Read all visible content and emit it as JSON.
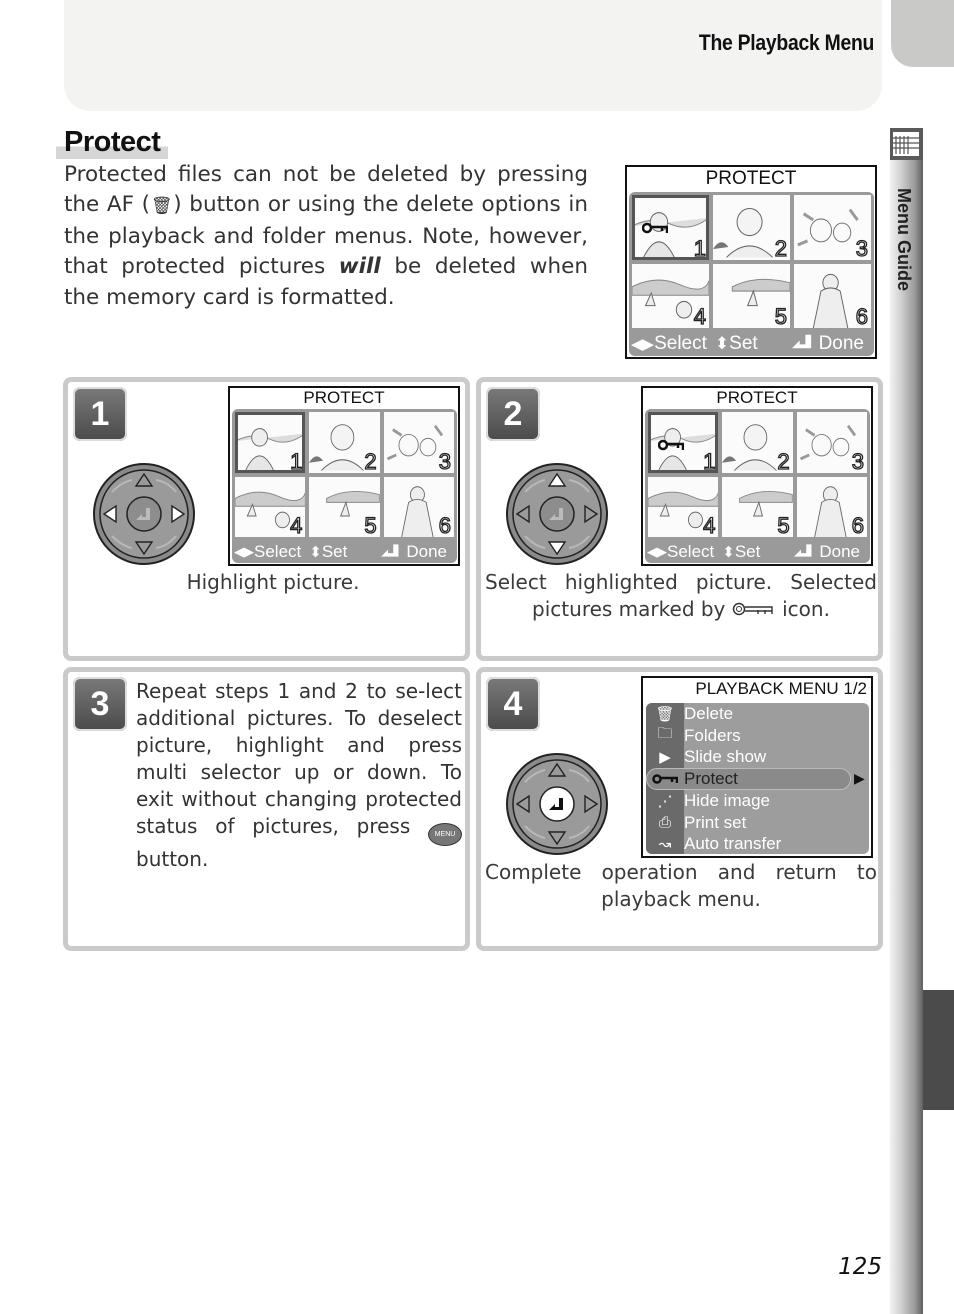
{
  "header": {
    "title": "The Playback Menu"
  },
  "side_tab": {
    "label": "Menu Guide",
    "icon": "menu-guide-icon"
  },
  "page_number": "125",
  "section": {
    "title": "Protect",
    "intro_before_icon": "Protected files can not be deleted by pressing the AF (",
    "intro_icon": "trash-icon",
    "intro_after_icon": ") button or using the delete options in the playback and folder menus.  Note, however, that protected pictures ",
    "intro_emphasis": "will",
    "intro_end": " be deleted when the memory card is formatted."
  },
  "lcd_protect": {
    "title": "PROTECT",
    "thumbnails": [
      {
        "number": "1",
        "subject": "woman-by-lake",
        "protected": true,
        "selected": true
      },
      {
        "number": "2",
        "subject": "boy-portrait",
        "protected": false,
        "selected": false
      },
      {
        "number": "3",
        "subject": "flowers",
        "protected": false,
        "selected": false
      },
      {
        "number": "4",
        "subject": "boy-by-sailboat",
        "protected": false,
        "selected": false
      },
      {
        "number": "5",
        "subject": "sailboat",
        "protected": false,
        "selected": false
      },
      {
        "number": "6",
        "subject": "woman-standing",
        "protected": false,
        "selected": false
      }
    ],
    "footer": {
      "select_icon": "◂▸",
      "select_label": "Select",
      "set_icon": "⬍",
      "set_label": "Set",
      "done_icon": "◢┛",
      "done_label": "Done"
    }
  },
  "steps": [
    {
      "number": "1",
      "caption": "Highlight picture.",
      "multi_selector_highlight": "left-right",
      "lcd": {
        "title": "PROTECT",
        "thumbnails": [
          {
            "number": "1",
            "protected": false,
            "selected": true
          },
          {
            "number": "2",
            "protected": false,
            "selected": false
          },
          {
            "number": "3",
            "protected": false,
            "selected": false
          },
          {
            "number": "4",
            "protected": false,
            "selected": false
          },
          {
            "number": "5",
            "protected": false,
            "selected": false
          },
          {
            "number": "6",
            "protected": false,
            "selected": false
          }
        ],
        "footer": {
          "select_label": "Select",
          "set_label": "Set",
          "done_label": "Done"
        }
      }
    },
    {
      "number": "2",
      "caption_before_icon": "Select highlighted picture.  Selected pictures marked by ",
      "caption_icon": "key-icon",
      "caption_after_icon": " icon.",
      "multi_selector_highlight": "up-down",
      "lcd": {
        "title": "PROTECT",
        "thumbnails": [
          {
            "number": "1",
            "protected": true,
            "selected": true
          },
          {
            "number": "2",
            "protected": false,
            "selected": false
          },
          {
            "number": "3",
            "protected": false,
            "selected": false
          },
          {
            "number": "4",
            "protected": false,
            "selected": false
          },
          {
            "number": "5",
            "protected": false,
            "selected": false
          },
          {
            "number": "6",
            "protected": false,
            "selected": false
          }
        ],
        "footer": {
          "select_label": "Select",
          "set_label": "Set",
          "done_label": "Done"
        }
      }
    },
    {
      "number": "3",
      "text_before_icon": "Repeat steps 1 and 2 to se-lect additional pictures.  To deselect picture, highlight and press multi selector up or down.  To exit without changing protected status of pictures, press ",
      "text_icon_label": "MENU",
      "text_after_icon": " button."
    },
    {
      "number": "4",
      "caption": "Complete operation and return to playback menu.",
      "multi_selector_highlight": "center",
      "menu": {
        "title": "PLAYBACK MENU 1/2",
        "items": [
          {
            "label": "Delete",
            "icon": "trash-icon",
            "glyph": "🗑",
            "active": false
          },
          {
            "label": "Folders",
            "icon": "folder-icon",
            "glyph": "🗀",
            "active": false
          },
          {
            "label": "Slide show",
            "icon": "slideshow-icon",
            "glyph": "▶",
            "active": false
          },
          {
            "label": "Protect",
            "icon": "key-icon",
            "glyph": "o━╖",
            "active": true
          },
          {
            "label": "Hide image",
            "icon": "hide-image-icon",
            "glyph": "⋰",
            "active": false
          },
          {
            "label": "Print set",
            "icon": "print-set-icon",
            "glyph": "⎙",
            "active": false
          },
          {
            "label": "Auto transfer",
            "icon": "auto-transfer-icon",
            "glyph": "↝",
            "active": false
          }
        ],
        "submenu_arrow": "▶"
      }
    }
  ],
  "colors": {
    "panel_border": "#cacaca",
    "badge": "#5a5a5a",
    "header_bg": "#f3f3f2",
    "lcd_gray": "#9a9a9a"
  }
}
